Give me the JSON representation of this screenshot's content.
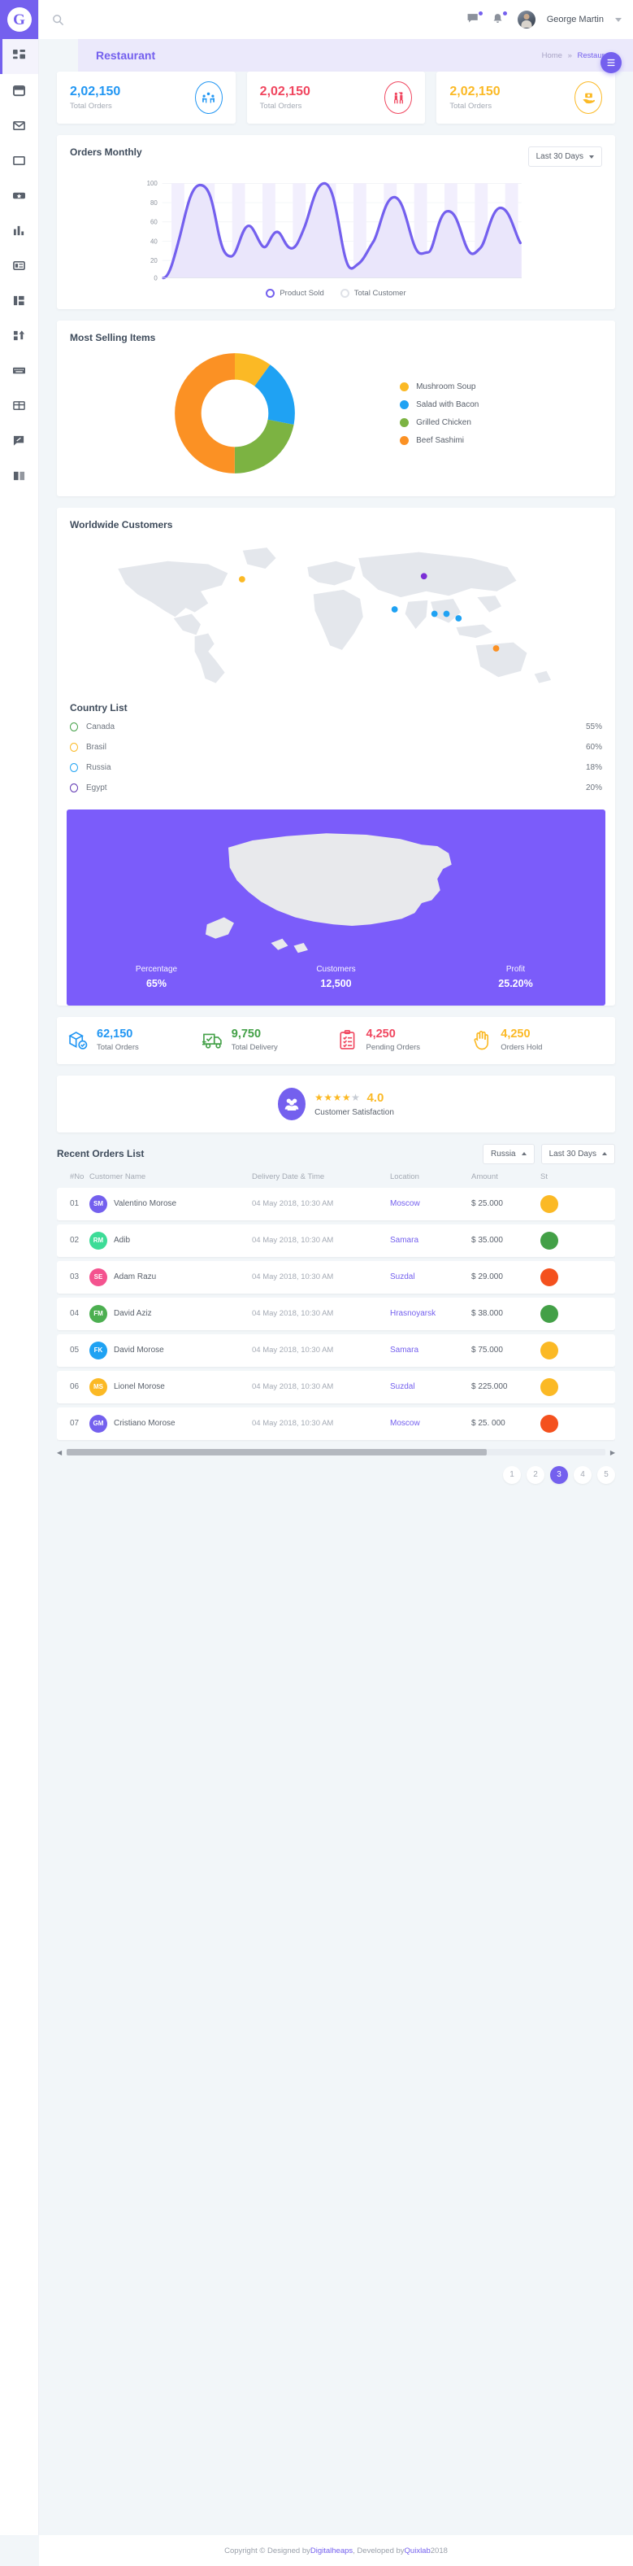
{
  "brand": {
    "logo_text": "G"
  },
  "topbar": {
    "search_placeholder": "",
    "search_value": "",
    "user_name": "George Martin",
    "icons": [
      "chat-icon",
      "bell-icon"
    ]
  },
  "titlebar": {
    "title": "Restaurant",
    "breadcrumb_home": "Home",
    "breadcrumb_sep": "»",
    "breadcrumb_current": "Restaurant"
  },
  "sidebar": {
    "items": [
      {
        "name": "dashboard",
        "active": true
      },
      {
        "name": "apps",
        "active": false
      },
      {
        "name": "mail",
        "active": false
      },
      {
        "name": "ui-elements",
        "active": false
      },
      {
        "name": "cards",
        "active": false
      },
      {
        "name": "charts",
        "active": false
      },
      {
        "name": "widgets",
        "active": false
      },
      {
        "name": "layouts",
        "active": false
      },
      {
        "name": "forms",
        "active": false
      },
      {
        "name": "keyboard",
        "active": false
      },
      {
        "name": "tables",
        "active": false
      },
      {
        "name": "editor",
        "active": false
      },
      {
        "name": "documentation",
        "active": false
      }
    ]
  },
  "stat_cards": [
    {
      "value": "2,02,150",
      "label": "Total Orders",
      "color": "#2196f3",
      "icon": "people-table-icon"
    },
    {
      "value": "2,02,150",
      "label": "Total Orders",
      "color": "#f0465f",
      "icon": "waiter-icon"
    },
    {
      "value": "2,02,150",
      "label": "Total Orders",
      "color": "#fbb925",
      "icon": "money-hand-icon"
    }
  ],
  "orders_monthly": {
    "title": "Orders Monthly",
    "dropdown": "Last 30 Days",
    "legend": [
      {
        "label": "Product Sold",
        "color": "#7460ee"
      },
      {
        "label": "Total Customer",
        "color": "#dfe2e8"
      }
    ]
  },
  "most_selling": {
    "title": "Most Selling Items",
    "legend": [
      {
        "label": "Mushroom Soup",
        "color": "#fbb925"
      },
      {
        "label": "Salad with Bacon",
        "color": "#1fa2f3"
      },
      {
        "label": "Grilled Chicken",
        "color": "#7cb342"
      },
      {
        "label": "Beef Sashimi",
        "color": "#fb9124"
      }
    ]
  },
  "worldwide": {
    "title": "Worldwide Customers",
    "markers": [
      {
        "color": "#fbb925",
        "x": 30.5,
        "y": 27
      },
      {
        "color": "#7b2fd6",
        "x": 68.3,
        "y": 25
      },
      {
        "color": "#1fa2f3",
        "x": 62.2,
        "y": 47
      },
      {
        "color": "#1fa2f3",
        "x": 70.4,
        "y": 50
      },
      {
        "color": "#1fa2f3",
        "x": 73.0,
        "y": 50
      },
      {
        "color": "#1fa2f3",
        "x": 75.4,
        "y": 53
      },
      {
        "color": "#fb9124",
        "x": 83.3,
        "y": 73
      }
    ]
  },
  "country_list": {
    "title": "Country List",
    "rows": [
      {
        "name": "Canada",
        "pct": "55%",
        "color": "#43a047"
      },
      {
        "name": "Brasil",
        "pct": "60%",
        "color": "#fbb925"
      },
      {
        "name": "Russia",
        "pct": "18%",
        "color": "#1fa2f3"
      },
      {
        "name": "Egypt",
        "pct": "20%",
        "color": "#5e35b1"
      }
    ]
  },
  "usa_panel": {
    "bg_color": "#7b5cfa",
    "stats": [
      {
        "label": "Percentage",
        "value": "65%"
      },
      {
        "label": "Customers",
        "value": "12,500"
      },
      {
        "label": "Profit",
        "value": "25.20%"
      }
    ]
  },
  "metrics": [
    {
      "value": "62,150",
      "label": "Total Orders",
      "color": "#2196f3",
      "icon": "package-check-icon"
    },
    {
      "value": "9,750",
      "label": "Total Delivery",
      "color": "#43a047",
      "icon": "delivery-truck-icon"
    },
    {
      "value": "4,250",
      "label": "Pending Orders",
      "color": "#f0465f",
      "icon": "clipboard-list-icon"
    },
    {
      "value": "4,250",
      "label": "Orders Hold",
      "color": "#fbb925",
      "icon": "hand-stop-icon"
    }
  ],
  "satisfaction": {
    "rating": "4.0",
    "stars_filled": 4,
    "stars_total": 5,
    "label": "Customer Satisfaction",
    "icon": "users-group-icon"
  },
  "recent_orders": {
    "title": "Recent Orders List",
    "filter_country": "Russia",
    "filter_period": "Last 30 Days",
    "columns": [
      "#No",
      "Customer Name",
      "Delivery Date & Time",
      "Location",
      "Amount",
      "St"
    ],
    "rows": [
      {
        "no": "01",
        "initials": "SM",
        "avatar_color": "#7460ee",
        "name": "Valentino Morose",
        "date": "04 May 2018, 10:30 AM",
        "location": "Moscow",
        "amount": "$ 25.000",
        "status_color": "#fbb925"
      },
      {
        "no": "02",
        "initials": "RM",
        "avatar_color": "#3ddc97",
        "name": "Adib",
        "date": "04 May 2018, 10:30 AM",
        "location": "Samara",
        "amount": "$ 35.000",
        "status_color": "#43a047"
      },
      {
        "no": "03",
        "initials": "SE",
        "avatar_color": "#f4538f",
        "name": "Adam Razu",
        "date": "04 May 2018, 10:30 AM",
        "location": "Suzdal",
        "amount": "$ 29.000",
        "status_color": "#f4511e"
      },
      {
        "no": "04",
        "initials": "FM",
        "avatar_color": "#4caf50",
        "name": "David Aziz",
        "date": "04 May 2018, 10:30 AM",
        "location": "Hrasnoyarsk",
        "amount": "$ 38.000",
        "status_color": "#43a047"
      },
      {
        "no": "05",
        "initials": "FK",
        "avatar_color": "#1fa2f3",
        "name": "David Morose",
        "date": "04 May 2018, 10:30 AM",
        "location": "Samara",
        "amount": "$ 75.000",
        "status_color": "#fbb925"
      },
      {
        "no": "06",
        "initials": "MS",
        "avatar_color": "#fbb925",
        "name": "Lionel Morose",
        "date": "04 May 2018, 10:30 AM",
        "location": "Suzdal",
        "amount": "$ 225.000",
        "status_color": "#fbb925"
      },
      {
        "no": "07",
        "initials": "GM",
        "avatar_color": "#7460ee",
        "name": "Cristiano Morose",
        "date": "04 May 2018, 10:30 AM",
        "location": "Moscow",
        "amount": "$ 25. 000",
        "status_color": "#f4511e"
      }
    ],
    "pagination": {
      "pages": [
        "1",
        "2",
        "3",
        "4",
        "5"
      ],
      "active": "3"
    }
  },
  "footer": {
    "prefix": "Copyright © Designed by ",
    "link1": "Digitalheaps",
    "middle": ", Developed by ",
    "link2": "Quixlab",
    "suffix": " 2018"
  },
  "chart_data": [
    {
      "type": "area",
      "title": "Orders Monthly",
      "xlabel": "",
      "ylabel": "",
      "ylim": [
        0,
        100
      ],
      "yticks": [
        0,
        20,
        40,
        60,
        80,
        100
      ],
      "grid": true,
      "legend_position": "bottom",
      "series": [
        {
          "name": "Product Sold",
          "color": "#7460ee",
          "values": [
            0,
            34,
            97,
            93,
            36,
            70,
            44,
            63,
            45,
            100,
            20,
            40,
            87,
            60,
            33,
            75,
            38,
            71,
            44
          ]
        },
        {
          "name": "Total Customer",
          "color": "#dfe2e8",
          "values": []
        }
      ]
    },
    {
      "type": "pie",
      "title": "Most Selling Items",
      "labels": [
        "Mushroom Soup",
        "Salad with Bacon",
        "Grilled Chicken",
        "Beef Sashimi"
      ],
      "values": [
        10,
        18,
        22,
        50
      ],
      "colors": [
        "#fbb925",
        "#1fa2f3",
        "#7cb342",
        "#fb9124"
      ],
      "legend_position": "right"
    },
    {
      "type": "bar",
      "title": "Country List",
      "categories": [
        "Canada",
        "Brasil",
        "Russia",
        "Egypt"
      ],
      "values": [
        55,
        60,
        18,
        20
      ],
      "ylabel": "%",
      "ylim": [
        0,
        100
      ]
    }
  ]
}
